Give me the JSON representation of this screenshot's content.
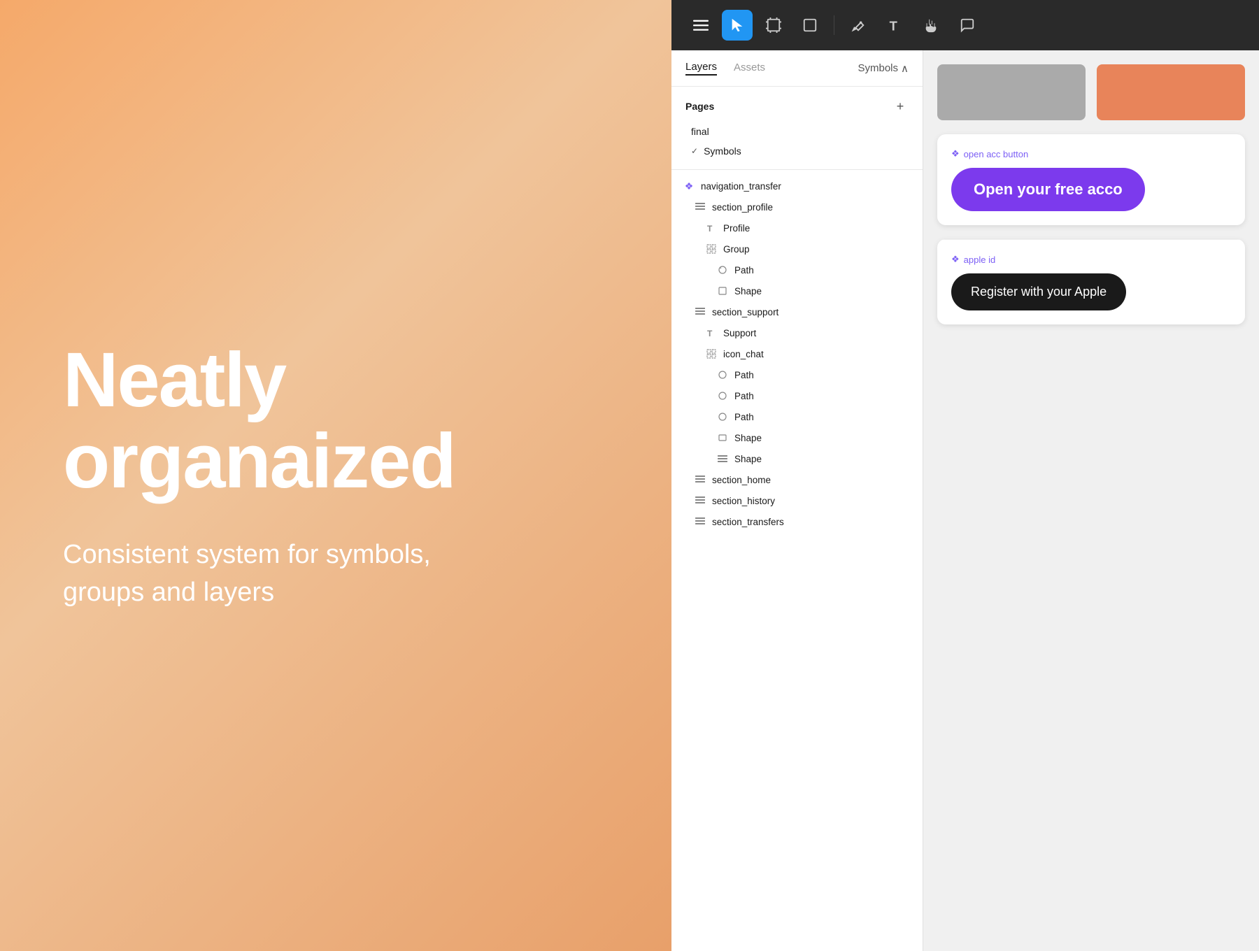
{
  "left": {
    "main_heading": "Neatly organaized",
    "sub_heading": "Consistent system for symbols, groups and layers"
  },
  "toolbar": {
    "menu_icon": "☰",
    "select_icon": "▶",
    "frame_icon": "#",
    "shape_icon": "□",
    "pen_icon": "✒",
    "text_icon": "T",
    "hand_icon": "✋",
    "comment_icon": "💬"
  },
  "panel": {
    "tabs": {
      "layers": "Layers",
      "assets": "Assets",
      "symbols": "Symbols"
    },
    "pages_title": "Pages",
    "pages": [
      {
        "label": "final",
        "check": false
      },
      {
        "label": "Symbols",
        "check": true
      }
    ],
    "layers": [
      {
        "label": "navigation_transfer",
        "icon": "sym",
        "indent": 0
      },
      {
        "label": "section_profile",
        "icon": "stack",
        "indent": 1
      },
      {
        "label": "Profile",
        "icon": "text",
        "indent": 2
      },
      {
        "label": "Group",
        "icon": "group",
        "indent": 2
      },
      {
        "label": "Path",
        "icon": "path",
        "indent": 3
      },
      {
        "label": "Shape",
        "icon": "shape",
        "indent": 3
      },
      {
        "label": "section_support",
        "icon": "stack",
        "indent": 1
      },
      {
        "label": "Support",
        "icon": "text",
        "indent": 2
      },
      {
        "label": "icon_chat",
        "icon": "group",
        "indent": 2
      },
      {
        "label": "Path",
        "icon": "path",
        "indent": 3
      },
      {
        "label": "Path",
        "icon": "path",
        "indent": 3
      },
      {
        "label": "Path",
        "icon": "path",
        "indent": 3
      },
      {
        "label": "Shape",
        "icon": "shape_rect",
        "indent": 3
      },
      {
        "label": "Shape",
        "icon": "stack_small",
        "indent": 3
      },
      {
        "label": "section_home",
        "icon": "stack",
        "indent": 1
      },
      {
        "label": "section_history",
        "icon": "stack",
        "indent": 1
      },
      {
        "label": "section_transfers",
        "icon": "stack",
        "indent": 1
      }
    ]
  },
  "canvas": {
    "open_acc_label": "open acc button",
    "open_acc_text": "Open your free acco",
    "apple_id_label": "apple id",
    "apple_id_text": "Register with your Apple"
  }
}
